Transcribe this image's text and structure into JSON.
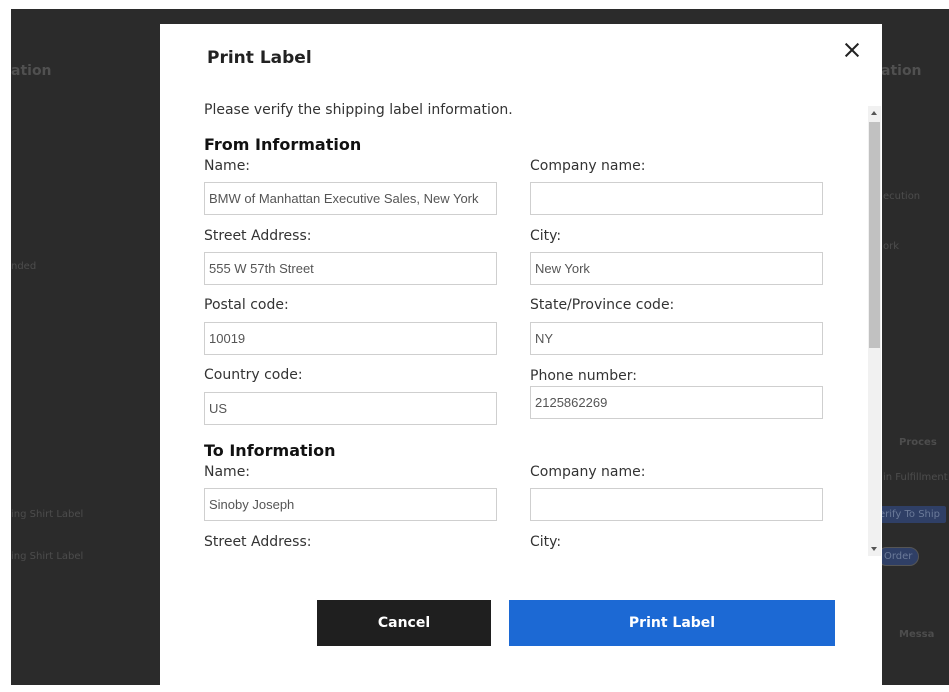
{
  "background": {
    "texts": [
      "ation",
      "ation",
      "nded",
      "ecution",
      "ork",
      "Proces",
      "in Fulfillment",
      "ing Shirt Label",
      "ing Shirt Label",
      "Messa"
    ],
    "pills": [
      "erify To Ship",
      "Order"
    ]
  },
  "modal": {
    "title": "Print Label",
    "intro": "Please verify the shipping label information.",
    "from": {
      "heading": "From Information",
      "name_label": "Name:",
      "name_value": "BMW of Manhattan Executive Sales, New York",
      "company_label": "Company name:",
      "company_value": "",
      "street_label": "Street Address:",
      "street_value": "555 W 57th Street",
      "city_label": "City:",
      "city_value": "New York",
      "postal_label": "Postal code:",
      "postal_value": "10019",
      "state_label": "State/Province code:",
      "state_value": "NY",
      "country_label": "Country code:",
      "country_value": "US",
      "phone_label": "Phone number:",
      "phone_value": "2125862269"
    },
    "to": {
      "heading": "To Information",
      "name_label": "Name:",
      "name_value": "Sinoby Joseph",
      "company_label": "Company name:",
      "company_value": "",
      "street_label": "Street Address:",
      "city_label": "City:"
    },
    "buttons": {
      "cancel": "Cancel",
      "print": "Print Label"
    }
  },
  "colors": {
    "overlay": "#2b2b2b",
    "primary_button": "#1c69d4",
    "cancel_button": "#1f1f1f"
  }
}
